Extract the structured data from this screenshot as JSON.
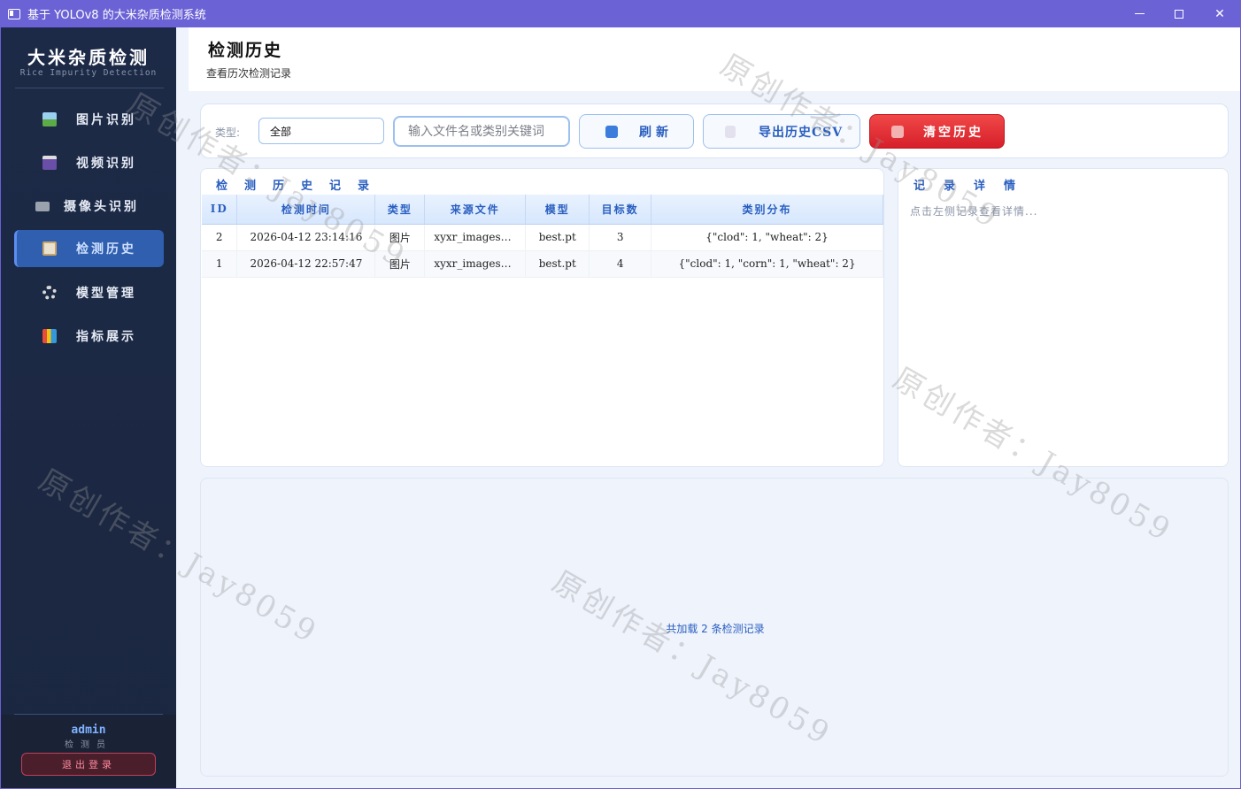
{
  "window": {
    "title": "基于 YOLOv8 的大米杂质检测系统"
  },
  "sidebar": {
    "brand_title": "大米杂质检测",
    "brand_subtitle": "Rice Impurity Detection",
    "items": [
      {
        "label": "图片识别",
        "icon": "image-icon"
      },
      {
        "label": "视频识别",
        "icon": "video-icon"
      },
      {
        "label": "摄像头识别",
        "icon": "camera-icon"
      },
      {
        "label": "检测历史",
        "icon": "history-icon",
        "active": true
      },
      {
        "label": "模型管理",
        "icon": "gear-icon"
      },
      {
        "label": "指标展示",
        "icon": "chart-icon"
      }
    ],
    "user": {
      "name": "admin",
      "role": "检测员"
    },
    "logout_label": "退出登录"
  },
  "header": {
    "title": "检测历史",
    "subtitle": "查看历次检测记录"
  },
  "toolbar": {
    "type_label": "类型:",
    "type_value": "全部",
    "search_placeholder": "输入文件名或类别关键词",
    "refresh_label": "刷新",
    "export_label": "导出历史CSV",
    "clear_label": "清空历史"
  },
  "history": {
    "title": "检测历史记录",
    "columns": [
      "ID",
      "检测时间",
      "类型",
      "来源文件",
      "模型",
      "目标数",
      "类别分布"
    ],
    "rows": [
      [
        "2",
        "2026-04-12 23:14:16",
        "图片",
        "xyxr_images…",
        "best.pt",
        "3",
        "{\"clod\": 1, \"wheat\": 2}"
      ],
      [
        "1",
        "2026-04-12 22:57:47",
        "图片",
        "xyxr_images…",
        "best.pt",
        "4",
        "{\"clod\": 1, \"corn\": 1, \"wheat\": 2}"
      ]
    ]
  },
  "detail": {
    "title": "记录详情",
    "placeholder": "点击左侧记录查看详情..."
  },
  "status": {
    "text": "共加载 2 条检测记录"
  },
  "watermark": "原创作者：Jay8059",
  "colors": {
    "titlebar": "#6b62d6",
    "sidebar": "#1d2a47",
    "accent": "#2a5fc0",
    "danger": "#e53935"
  }
}
